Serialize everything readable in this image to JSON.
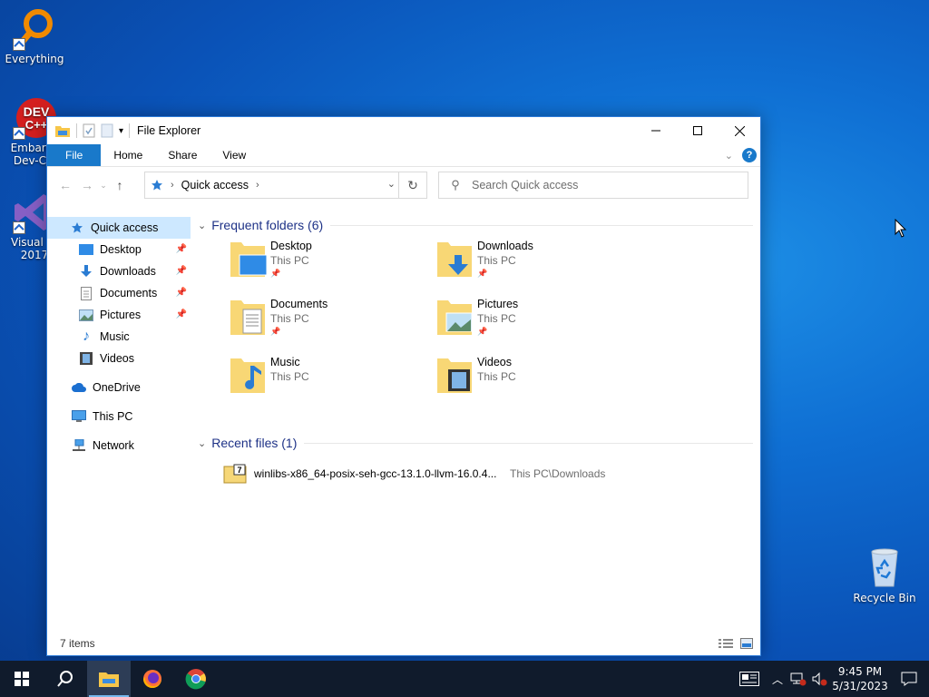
{
  "desktop": {
    "icons": [
      {
        "label": "Everything"
      },
      {
        "label1": "Embarca",
        "label2": "Dev-C+"
      },
      {
        "label1": "Visual St",
        "label2": "2017"
      },
      {
        "label": "Recycle Bin"
      }
    ]
  },
  "window": {
    "title": "File Explorer",
    "ribbon": {
      "file": "File",
      "home": "Home",
      "share": "Share",
      "view": "View",
      "help": "?"
    },
    "address": {
      "location": "Quick access"
    },
    "search": {
      "placeholder": "Search Quick access"
    },
    "sidebar": [
      {
        "label": "Quick access",
        "icon": "star-icon",
        "active": true
      },
      {
        "label": "Desktop",
        "icon": "desktop-icon",
        "pinned": true
      },
      {
        "label": "Downloads",
        "icon": "download-arrow-icon",
        "pinned": true
      },
      {
        "label": "Documents",
        "icon": "document-icon",
        "pinned": true
      },
      {
        "label": "Pictures",
        "icon": "pictures-icon",
        "pinned": true
      },
      {
        "label": "Music",
        "icon": "music-note-icon"
      },
      {
        "label": "Videos",
        "icon": "video-icon"
      },
      {
        "label": "OneDrive",
        "icon": "cloud-icon"
      },
      {
        "label": "This PC",
        "icon": "computer-icon"
      },
      {
        "label": "Network",
        "icon": "network-icon"
      }
    ],
    "frequent": {
      "header": "Frequent folders (6)",
      "items": [
        {
          "name": "Desktop",
          "location": "This PC",
          "pinned": true
        },
        {
          "name": "Downloads",
          "location": "This PC",
          "pinned": true
        },
        {
          "name": "Documents",
          "location": "This PC",
          "pinned": true
        },
        {
          "name": "Pictures",
          "location": "This PC",
          "pinned": true
        },
        {
          "name": "Music",
          "location": "This PC"
        },
        {
          "name": "Videos",
          "location": "This PC"
        }
      ]
    },
    "recent": {
      "header": "Recent files (1)",
      "items": [
        {
          "name": "winlibs-x86_64-posix-seh-gcc-13.1.0-llvm-16.0.4...",
          "path": "This PC\\Downloads"
        }
      ]
    },
    "status": {
      "items": "7 items"
    }
  },
  "taskbar": {
    "time": "9:45 PM",
    "date": "5/31/2023"
  },
  "colors": {
    "accent": "#1979ca",
    "selection": "#cde8ff",
    "group_header": "#1e3287",
    "taskbar": "#101b2c"
  }
}
